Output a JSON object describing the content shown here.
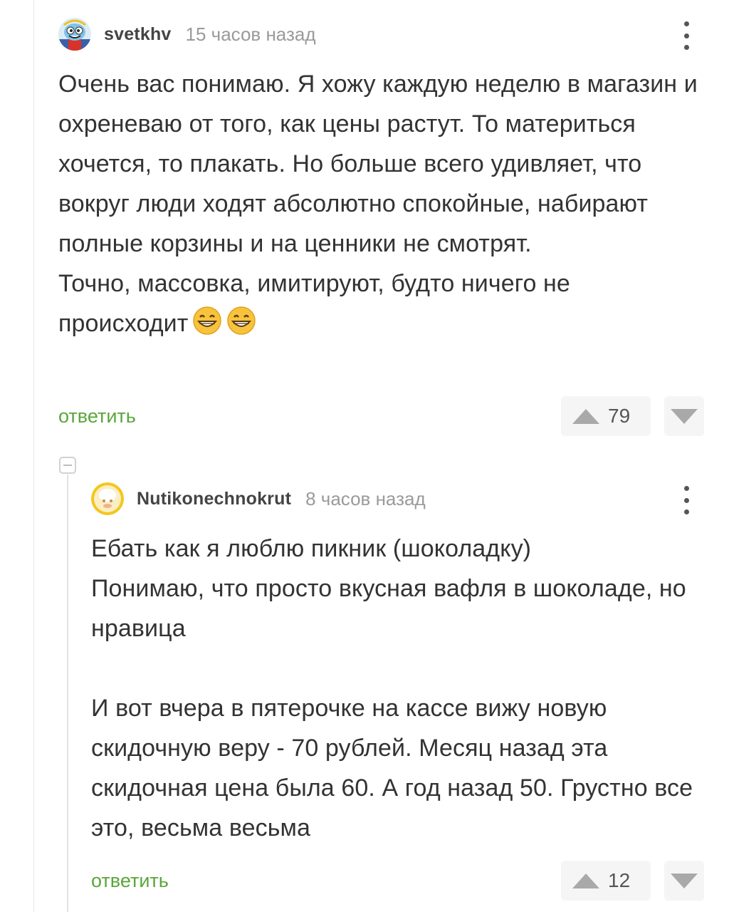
{
  "comments": [
    {
      "username": "svetkhv",
      "time": "15 часов назад",
      "paragraphs": [
        "Очень вас понимаю. Я хожу каждую неделю в магазин и охреневаю от того, как цены растут. То материться хочется, то плакать. Но больше всего удивляет, что вокруг люди ходят абсолютно спокойные, набирают полные корзины и на ценники не смотрят.",
        "Точно, массовка, имитируют, будто ничего не происходит"
      ],
      "emoji": "grinning-face-with-smiling-eyes",
      "reply_label": "ответить",
      "rating": "79"
    },
    {
      "username": "Nutikonechnokrut",
      "time": "8 часов назад",
      "paragraphs": [
        "Ебать как я люблю пикник (шоколадку)",
        "Понимаю, что просто вкусная вафля в шоколаде, но нравица",
        "И вот вчера в пятерочке на кассе вижу новую скидочную веру - 70 рублей. Месяц назад эта скидочная цена была 60. А год назад 50. Грустно все это, весьма весьма"
      ],
      "reply_label": "ответить",
      "rating": "12"
    }
  ],
  "colors": {
    "reply_link": "#5aa63a",
    "text": "#333333",
    "meta": "#9a9a9a",
    "vote_bg": "#f5f5f5",
    "vote_arrow": "#a9a9a9"
  },
  "icons": {
    "more": "more-vertical-icon",
    "upvote": "arrow-up-icon",
    "downvote": "arrow-down-icon",
    "collapse": "collapse-minus-icon"
  }
}
